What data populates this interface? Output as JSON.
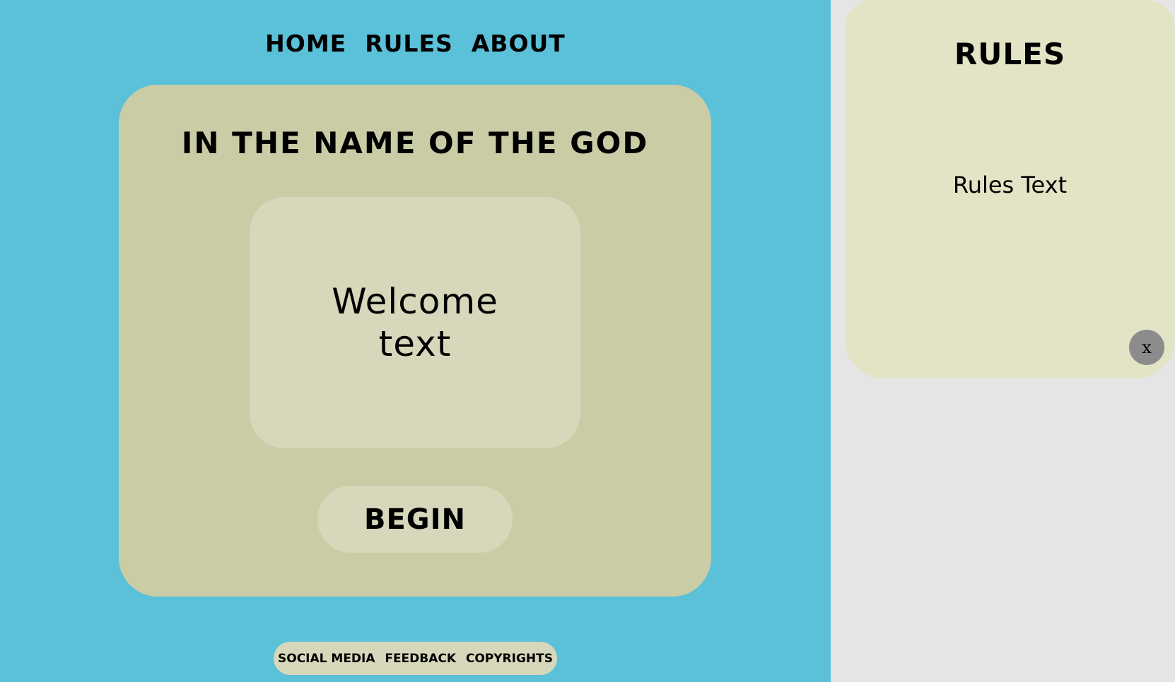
{
  "nav": {
    "items": [
      {
        "label": "HOME"
      },
      {
        "label": "RULES"
      },
      {
        "label": "ABOUT"
      }
    ]
  },
  "main": {
    "title": "IN THE NAME OF THE GOD",
    "welcome_text": "Welcome text",
    "begin_label": "BEGIN"
  },
  "footer": {
    "items": [
      {
        "label": "SOCIAL MEDIA"
      },
      {
        "label": "FEEDBACK"
      },
      {
        "label": "COPYRIGHTS"
      }
    ]
  },
  "rules_panel": {
    "title": "RULES",
    "text": "Rules Text",
    "close_label": "x"
  },
  "colors": {
    "background": "#5ac1d9",
    "card": "#cacca6",
    "inner_box": "#d7d8bb",
    "side_background": "#e5e5e5",
    "rules_panel": "#e3e4c6",
    "close_button": "#8c8c8c"
  }
}
